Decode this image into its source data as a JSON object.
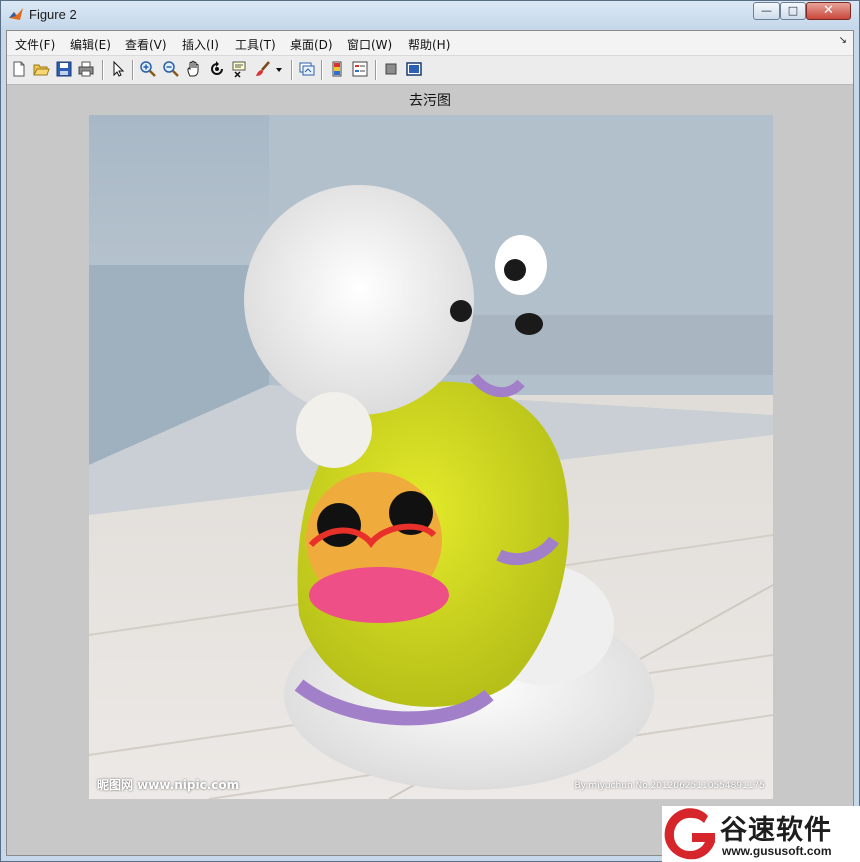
{
  "window": {
    "title": "Figure 2",
    "minimize_icon": "minimize-icon",
    "maximize_icon": "maximize-icon",
    "close_icon": "close-icon"
  },
  "menubar": {
    "items": [
      "文件(F)",
      "编辑(E)",
      "查看(V)",
      "插入(I)",
      "工具(T)",
      "桌面(D)",
      "窗口(W)",
      "帮助(H)"
    ],
    "overflow_icon": "chevron-icon"
  },
  "toolbar": {
    "buttons": [
      "new-figure",
      "open-file",
      "save-figure",
      "print-figure",
      "edit-plot-arrow",
      "zoom-in",
      "zoom-out",
      "pan",
      "rotate-3d",
      "data-cursor",
      "brush",
      "brush-dropdown",
      "link-plot",
      "insert-colorbar",
      "insert-legend",
      "hide-plot-tools",
      "show-plot-tools"
    ]
  },
  "plot": {
    "title": "去污图"
  },
  "image": {
    "subject": "poodle-in-yellow-hoodie",
    "watermark_left": "昵图网 www.nipic.com",
    "watermark_right": "By:miyuchun No.20120625110554891175"
  },
  "site_logo": {
    "name": "谷速软件",
    "url": "www.gususoft.com",
    "accent": "#d6262b"
  }
}
